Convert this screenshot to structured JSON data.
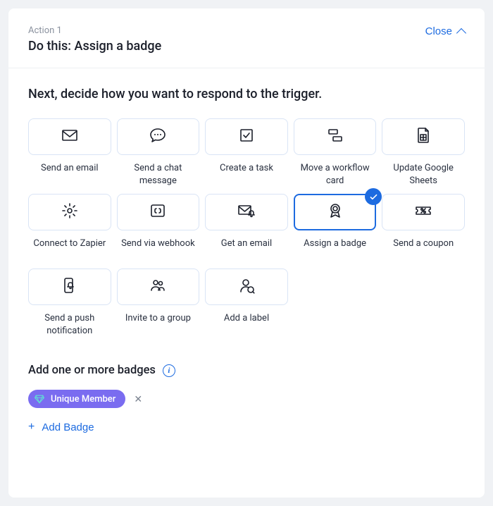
{
  "header": {
    "action_label": "Action 1",
    "title": "Do this: Assign a badge",
    "close_label": "Close"
  },
  "prompt": "Next, decide how you want to respond to the trigger.",
  "options": [
    {
      "id": "send-email",
      "label": "Send an email",
      "icon": "mail-icon",
      "selected": false
    },
    {
      "id": "send-chat",
      "label": "Send a chat message",
      "icon": "chat-icon",
      "selected": false
    },
    {
      "id": "create-task",
      "label": "Create a task",
      "icon": "checkbox-icon",
      "selected": false
    },
    {
      "id": "move-workflow-card",
      "label": "Move a workflow card",
      "icon": "kanban-icon",
      "selected": false
    },
    {
      "id": "update-sheets",
      "label": "Update Google Sheets",
      "icon": "sheet-icon",
      "selected": false
    },
    {
      "id": "connect-zapier",
      "label": "Connect to Zapier",
      "icon": "gear-icon",
      "selected": false
    },
    {
      "id": "send-webhook",
      "label": "Send via webhook",
      "icon": "bracket-icon",
      "selected": false
    },
    {
      "id": "get-email",
      "label": "Get an email",
      "icon": "mail-bell-icon",
      "selected": false
    },
    {
      "id": "assign-badge",
      "label": "Assign a badge",
      "icon": "badge-icon",
      "selected": true
    },
    {
      "id": "send-coupon",
      "label": "Send a coupon",
      "icon": "coupon-icon",
      "selected": false
    },
    {
      "id": "send-push",
      "label": "Send a push notification",
      "icon": "phone-bell-icon",
      "selected": false
    },
    {
      "id": "invite-group",
      "label": "Invite to a group",
      "icon": "group-icon",
      "selected": false
    },
    {
      "id": "add-label",
      "label": "Add a label",
      "icon": "person-label-icon",
      "selected": false
    }
  ],
  "badges_section": {
    "heading": "Add one or more badges",
    "chips": [
      {
        "label": "Unique Member"
      }
    ],
    "add_label": "Add Badge"
  }
}
